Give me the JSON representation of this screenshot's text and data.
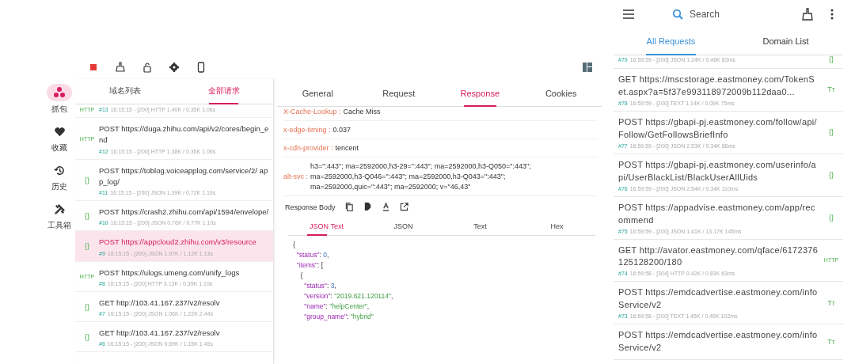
{
  "toolbar": {
    "recording": true
  },
  "nav": [
    {
      "label": "抓包",
      "selected": true
    },
    {
      "label": "收藏",
      "selected": false
    },
    {
      "label": "历史",
      "selected": false
    },
    {
      "label": "工具箱",
      "selected": false
    }
  ],
  "list_tabs": [
    {
      "label": "域名列表",
      "selected": false
    },
    {
      "label": "全部请求",
      "selected": true
    }
  ],
  "requests": [
    {
      "id": "#13",
      "meta": "16:15:15 - [200]  HTTP 1.40K / 0.35K  1.06s",
      "type": "HTTP",
      "selected": false
    },
    {
      "url": "POST https://duga.zhihu.com/api/v2/cores/begin_end",
      "id": "#12",
      "meta": "16:15:15 - [200]  HTTP 1.38K / 0.35K  1.06s",
      "type": "HTTP",
      "selected": false
    },
    {
      "url": "POST https://toblog.voiceapplog.com/service/2/ app_log/",
      "id": "#11",
      "meta": "16:15:15 - [200]  JSON 1.39K / 0.72K  1.10s",
      "type": "{}",
      "selected": false
    },
    {
      "url": "POST https://crash2.zhihu.com/api/1594/envelope/",
      "id": "#10",
      "meta": "16:15:15 - [200]  JSON 0.76K / 0.77K  1.10s",
      "type": "{}",
      "selected": false
    },
    {
      "url": "POST https://appcloud2.zhihu.com/v3/resource",
      "id": "#9",
      "meta": "16:15:15 - [200]  JSON 1.97K / 1.12K  1.13s",
      "type": "{}",
      "selected": true
    },
    {
      "url": "POST https://ulogs.umeng.com/unify_logs",
      "id": "#8",
      "meta": "16:15:15 - [200]  HTTP 3.13K / 0.39K  1.10s",
      "type": "HTTP",
      "selected": false
    },
    {
      "url": "GET http://103.41.167.237/v2/resolv",
      "id": "#7",
      "meta": "16:15:15 - [200]  JSON 1.06K / 1.22K  2.44s",
      "type": "{}",
      "selected": false
    },
    {
      "url": "GET http://103.41.167.237/v2/resolv",
      "id": "#6",
      "meta": "16:15:15 - [200]  JSON 0.69K / 1.15K  1.45s",
      "type": "{}",
      "selected": false
    }
  ],
  "detail_tabs": [
    {
      "label": "General",
      "selected": false
    },
    {
      "label": "Request",
      "selected": false
    },
    {
      "label": "Response",
      "selected": true
    },
    {
      "label": "Cookies",
      "selected": false
    }
  ],
  "headers": [
    {
      "name": "X-Cache-Lookup :",
      "value": [
        "Cache Miss"
      ]
    },
    {
      "name": "x-edge-timing :",
      "value": [
        "0.037"
      ]
    },
    {
      "name": "x-cdn-provider :",
      "value": [
        "tencent"
      ]
    },
    {
      "name": "alt-svc :",
      "value": [
        "h3=\":443\"; ma=2592000,h3-29=\":443\"; ma=2592000,h3-Q050=\":443\";",
        "ma=2592000,h3-Q046=\":443\"; ma=2592000,h3-Q043=\":443\";",
        "ma=2592000,quic=\":443\"; ma=2592000; v=\"46,43\""
      ]
    }
  ],
  "response_body": {
    "label": "Response Body",
    "tabs": [
      {
        "label": "JSON Text",
        "selected": true
      },
      {
        "label": "JSON",
        "selected": false
      },
      {
        "label": "Text",
        "selected": false
      },
      {
        "label": "Hex",
        "selected": false
      }
    ],
    "lines": [
      [
        {
          "kind": "punct",
          "text": "{"
        }
      ],
      [
        {
          "kind": "key",
          "text": "  \"status\""
        },
        {
          "kind": "punct",
          "text": ": "
        },
        {
          "kind": "number",
          "text": "0"
        },
        {
          "kind": "punct",
          "text": ","
        }
      ],
      [
        {
          "kind": "key",
          "text": "  \"items\""
        },
        {
          "kind": "punct",
          "text": ": ["
        }
      ],
      [
        {
          "kind": "punct",
          "text": "    {"
        }
      ],
      [
        {
          "kind": "key",
          "text": "      \"status\""
        },
        {
          "kind": "punct",
          "text": ": "
        },
        {
          "kind": "number",
          "text": "3"
        },
        {
          "kind": "punct",
          "text": ","
        }
      ],
      [
        {
          "kind": "key",
          "text": "      \"version\""
        },
        {
          "kind": "punct",
          "text": ": "
        },
        {
          "kind": "string",
          "text": "\"2019.621.120114\""
        },
        {
          "kind": "punct",
          "text": ","
        }
      ],
      [
        {
          "kind": "key",
          "text": "      \"name\""
        },
        {
          "kind": "punct",
          "text": ": "
        },
        {
          "kind": "string",
          "text": "\"helpCenter\""
        },
        {
          "kind": "punct",
          "text": ","
        }
      ],
      [
        {
          "kind": "key",
          "text": "      \"group_name\""
        },
        {
          "kind": "punct",
          "text": ": "
        },
        {
          "kind": "string",
          "text": "\"hybrid\""
        }
      ]
    ]
  },
  "mobile": {
    "search_placeholder": "Search",
    "tabs": [
      {
        "label": "All Requests",
        "selected": true
      },
      {
        "label": "Domain List",
        "selected": false
      }
    ],
    "requests": [
      {
        "id": "#79",
        "meta": "16:59:59 - [200] JSON 1.24K / 0.46K  83ms",
        "type": "{}"
      },
      {
        "url": "GET https://mscstorage.eastmoney.com/TokenSet.aspx?a=5f37e993118972009b112daa0...",
        "id": "#78",
        "meta": "16:59:59 - [200] TEXT 1.14K / 0.09K  75ms",
        "type": "Tт"
      },
      {
        "url": "POST https://gbapi-pj.eastmoney.com/follow/api/Follow/GetFollowsBriefInfo",
        "id": "#77",
        "meta": "16:59:59 - [200] JSON 2.53K / 0.34K  88ms",
        "type": "{}"
      },
      {
        "url": "POST https://gbapi-pj.eastmoney.com/userinfo/api/UserBlackList/BlackUserAllUids",
        "id": "#76",
        "meta": "16:59:59 - [200] JSON 2.54K / 0.34K  110ms",
        "type": "{}"
      },
      {
        "url": "POST https://appadvise.eastmoney.com/app/recommend",
        "id": "#75",
        "meta": "16:59:59 - [200] JSON 1.41K / 13.17K  145ms",
        "type": "{}"
      },
      {
        "url": "GET http://avator.eastmoney.com/qface/6172376125128200/180",
        "id": "#74",
        "meta": "16:59:58 - [304] HTTP 0.42K / 0.83K  63ms",
        "type": "HTTP"
      },
      {
        "url": "POST https://emdcadvertise.eastmoney.com/infoService/v2",
        "id": "#73",
        "meta": "16:59:58 - [200] TEXT 1.45K / 0.45K  102ms",
        "type": "Tт"
      },
      {
        "url": "POST https://emdcadvertise.eastmoney.com/infoService/v2",
        "type": "Tт"
      }
    ]
  }
}
